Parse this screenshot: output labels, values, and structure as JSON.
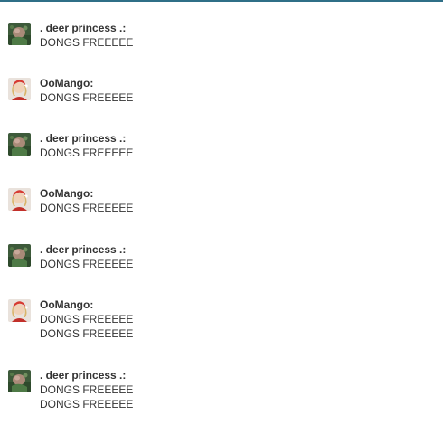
{
  "chat": {
    "messages": [
      {
        "user": ". deer princess .:",
        "avatar": "deer-princess-avatar-icon",
        "lines": [
          "DONGS FREEEEE"
        ]
      },
      {
        "user": "OoMango:",
        "avatar": "oomango-avatar-icon",
        "lines": [
          "DONGS FREEEEE"
        ]
      },
      {
        "user": ". deer princess .:",
        "avatar": "deer-princess-avatar-icon",
        "lines": [
          "DONGS FREEEEE"
        ]
      },
      {
        "user": "OoMango:",
        "avatar": "oomango-avatar-icon",
        "lines": [
          "DONGS FREEEEE"
        ]
      },
      {
        "user": ". deer princess .:",
        "avatar": "deer-princess-avatar-icon",
        "lines": [
          "DONGS FREEEEE"
        ]
      },
      {
        "user": "OoMango:",
        "avatar": "oomango-avatar-icon",
        "lines": [
          "DONGS FREEEEE",
          "DONGS FREEEEE"
        ]
      },
      {
        "user": ". deer princess .:",
        "avatar": "deer-princess-avatar-icon",
        "lines": [
          "DONGS FREEEEE",
          "DONGS FREEEEE"
        ]
      }
    ]
  },
  "colors": {
    "accent_rule": "#2f6f87",
    "text": "#333333"
  }
}
